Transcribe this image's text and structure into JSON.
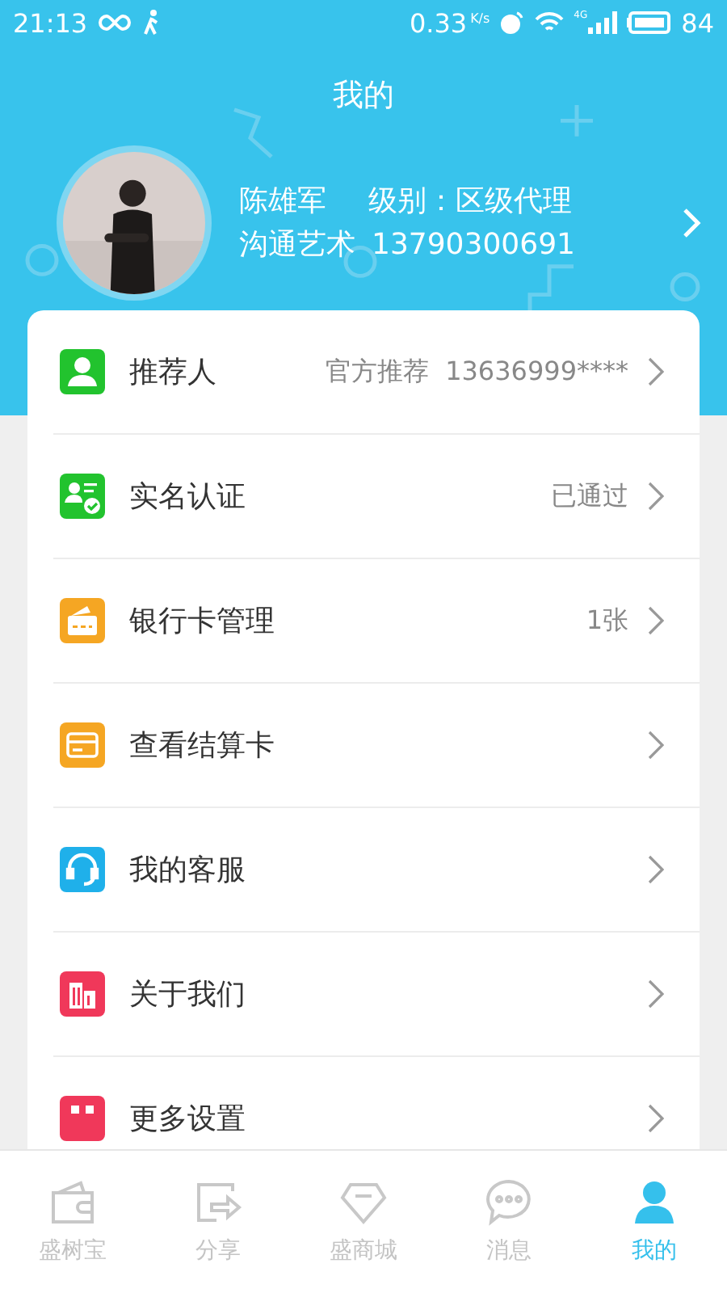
{
  "status_bar": {
    "time": "21:13",
    "speed": "0.33",
    "speed_unit": "K/s",
    "network": "4G",
    "battery": "84"
  },
  "header": {
    "title": "我的"
  },
  "profile": {
    "name": "陈雄军",
    "level_label": "级别：",
    "level": "区级代理",
    "company": "沟通艺术",
    "phone": "13790300691"
  },
  "menu": [
    {
      "kind": "person",
      "color": "#22c32e",
      "label": "推荐人",
      "value": "官方推荐  13636999****"
    },
    {
      "kind": "verified",
      "color": "#22c32e",
      "label": "实名认证",
      "value": "已通过"
    },
    {
      "kind": "bankcard",
      "color": "#f5a623",
      "label": "银行卡管理",
      "value": "1张"
    },
    {
      "kind": "card",
      "color": "#f5a623",
      "label": "查看结算卡"
    },
    {
      "kind": "headset",
      "color": "#1fb0ea",
      "label": "我的客服"
    },
    {
      "kind": "building",
      "color": "#f0385a",
      "label": "关于我们"
    },
    {
      "kind": "settings",
      "color": "#f0385a",
      "label": "更多设置"
    }
  ],
  "tabs": [
    {
      "kind": "wallet",
      "label": "盛树宝",
      "selected": false
    },
    {
      "kind": "share",
      "label": "分享",
      "selected": false
    },
    {
      "kind": "diamond",
      "label": "盛商城",
      "selected": false
    },
    {
      "kind": "chat",
      "label": "消息",
      "selected": false
    },
    {
      "kind": "user",
      "label": "我的",
      "selected": true
    }
  ]
}
